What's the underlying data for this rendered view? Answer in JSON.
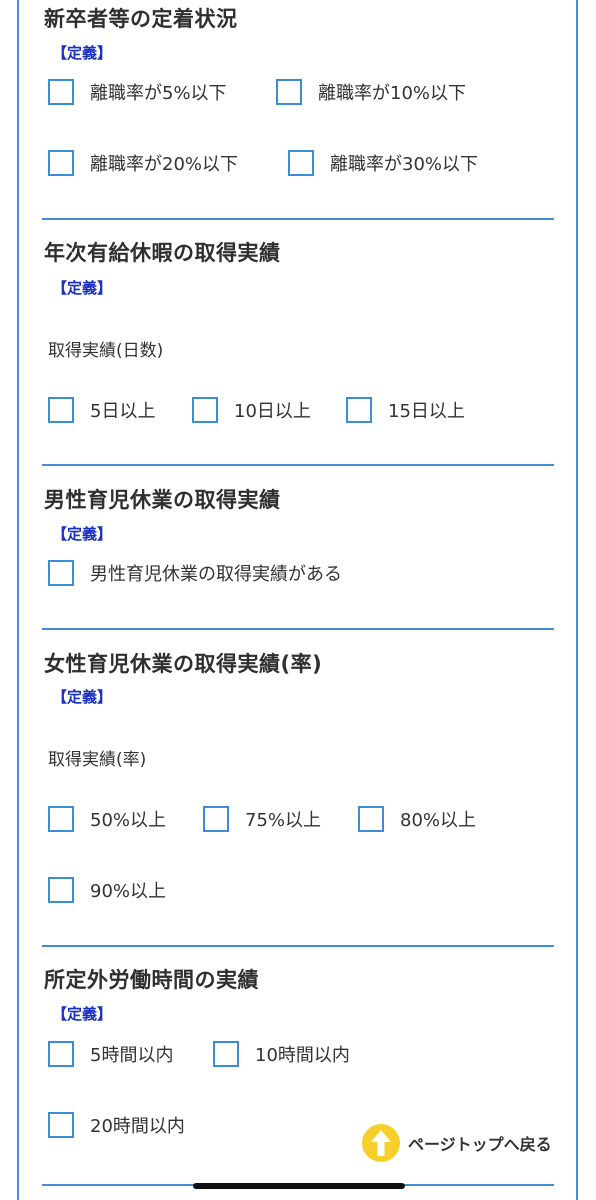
{
  "definition_label": "【定義】",
  "sections": [
    {
      "title": "新卒者等の定着状況",
      "options": [
        "離職率が5%以下",
        "離職率が10%以下",
        "離職率が20%以下",
        "離職率が30%以下"
      ]
    },
    {
      "title": "年次有給休暇の取得実績",
      "sub_label": "取得実績(日数)",
      "options": [
        "5日以上",
        "10日以上",
        "15日以上"
      ]
    },
    {
      "title": "男性育児休業の取得実績",
      "options": [
        "男性育児休業の取得実績がある"
      ]
    },
    {
      "title": "女性育児休業の取得実績(率)",
      "sub_label": "取得実績(率)",
      "options": [
        "50%以上",
        "75%以上",
        "80%以上",
        "90%以上"
      ]
    },
    {
      "title": "所定外労働時間の実績",
      "options": [
        "5時間以内",
        "10時間以内",
        "20時間以内"
      ]
    }
  ],
  "page_top": {
    "label": "ページトップへ戻る",
    "icon": "arrow-up-icon"
  },
  "colors": {
    "accent_blue": "#3f8fd2",
    "definition_link": "#1a2fc4",
    "page_top_circle": "#f7cf2a"
  }
}
